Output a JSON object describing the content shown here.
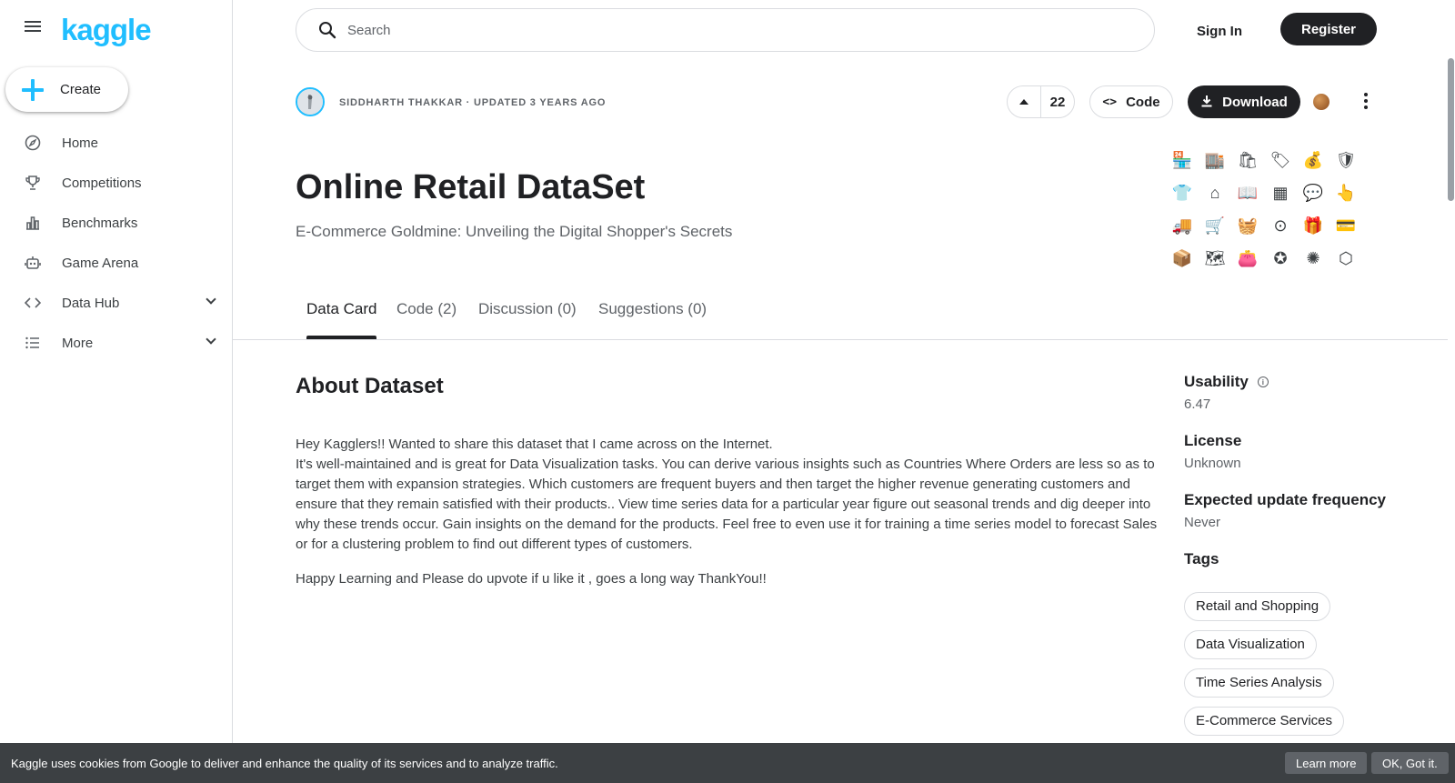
{
  "sidebar": {
    "logo": "kaggle",
    "create_label": "Create",
    "items": [
      {
        "label": "Home",
        "icon": "compass-icon"
      },
      {
        "label": "Competitions",
        "icon": "trophy-icon"
      },
      {
        "label": "Benchmarks",
        "icon": "bar-chart-icon"
      },
      {
        "label": "Game Arena",
        "icon": "robot-icon"
      },
      {
        "label": "Data Hub",
        "icon": "code-brackets-icon"
      },
      {
        "label": "More",
        "icon": "list-icon"
      }
    ]
  },
  "header": {
    "search_placeholder": "Search",
    "sign_in": "Sign In",
    "register": "Register"
  },
  "dataset": {
    "author_line": "SIDDHARTH THAKKAR · UPDATED 3 YEARS AGO",
    "votes": "22",
    "code_label": "Code",
    "download_label": "Download",
    "title": "Online Retail DataSet",
    "subtitle": "E-Commerce Goldmine: Unveiling the Digital Shopper's Secrets"
  },
  "tabs": [
    {
      "label": "Data Card"
    },
    {
      "label": "Code (2)"
    },
    {
      "label": "Discussion (0)"
    },
    {
      "label": "Suggestions (0)"
    }
  ],
  "about": {
    "heading": "About Dataset",
    "line1": "Hey Kagglers!! Wanted to share this dataset that I came across on the Internet.",
    "line2": "It's well-maintained and is great for Data Visualization tasks. You can derive various insights such as Countries Where Orders are less so as to target them with expansion strategies. Which customers are frequent buyers and then target the higher revenue generating customers and ensure that they remain satisfied with their products.. View time series data for a particular year figure out seasonal trends and dig deeper into why these trends occur. Gain insights on the demand for the products. Feel free to even use it for training a time series model to forecast Sales or for a clustering problem to find out different types of customers.",
    "line3": "Happy Learning and Please do upvote if u like it , goes a long way ThankYou!!"
  },
  "meta": {
    "usability_label": "Usability",
    "usability_value": "6.47",
    "license_label": "License",
    "license_value": "Unknown",
    "frequency_label": "Expected update frequency",
    "frequency_value": "Never",
    "tags_label": "Tags",
    "tags": [
      "Retail and Shopping",
      "Data Visualization",
      "Time Series Analysis",
      "E-Commerce Services"
    ]
  },
  "cookie": {
    "text": "Kaggle uses cookies from Google to deliver and enhance the quality of its services and to analyze traffic.",
    "learn_more": "Learn more",
    "ok": "OK, Got it."
  },
  "colors": {
    "brand": "#20beff",
    "dark": "#202124"
  }
}
